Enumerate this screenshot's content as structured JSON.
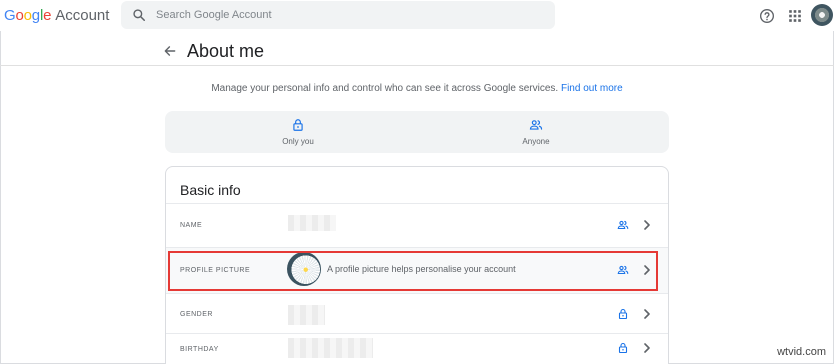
{
  "header": {
    "logo_google": "Google",
    "logo_account": "Account",
    "search_placeholder": "Search Google Account"
  },
  "page": {
    "title": "About me",
    "intro_text": "Manage your personal info and control who can see it across Google services. ",
    "intro_link": "Find out more"
  },
  "legend": {
    "only_you": "Only you",
    "anyone": "Anyone"
  },
  "basic_info": {
    "title": "Basic info",
    "rows": [
      {
        "label": "NAME",
        "visibility": "anyone"
      },
      {
        "label": "PROFILE PICTURE",
        "description": "A profile picture helps personalise your account",
        "visibility": "anyone"
      },
      {
        "label": "GENDER",
        "visibility": "only-you"
      },
      {
        "label": "BIRTHDAY",
        "visibility": "only-you"
      }
    ]
  },
  "watermark": "wtvid.com",
  "colors": {
    "accent": "#1a73e8",
    "highlight_border": "#e53935",
    "legend_bg": "#f1f3f4"
  }
}
